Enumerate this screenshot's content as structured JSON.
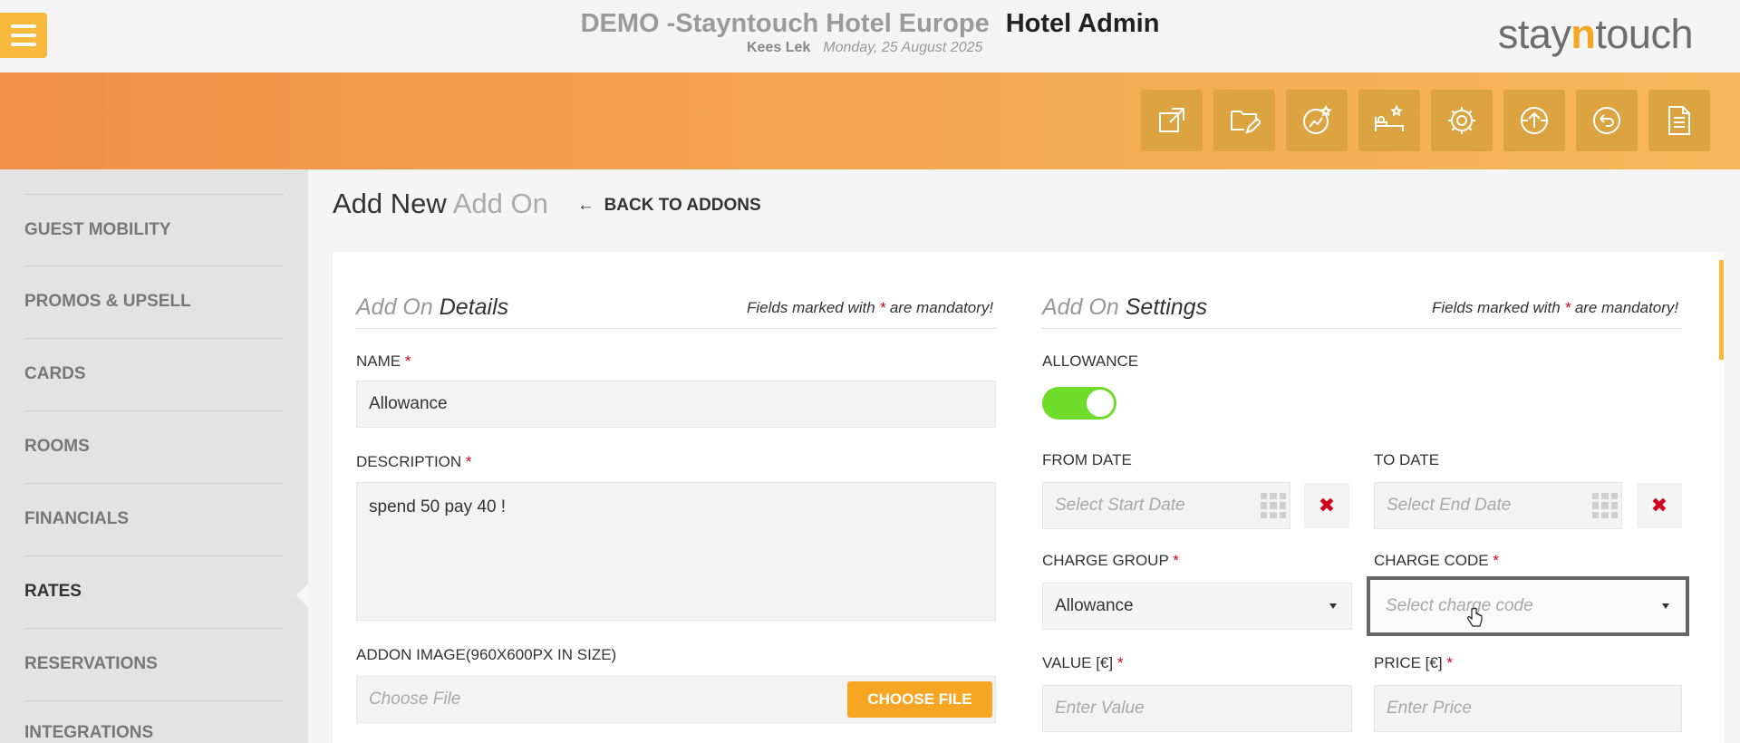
{
  "header": {
    "hotel_name": "DEMO -Stayntouch Hotel Europe",
    "app_name": "Hotel Admin",
    "user": "Kees Lek",
    "date": "Monday, 25 August 2025",
    "logo_left": "stay",
    "logo_n": "n",
    "logo_right": "touch"
  },
  "toolbar_icons": [
    "external-link-icon",
    "folder-edit-icon",
    "chart-star-icon",
    "bed-star-icon",
    "gear-icon",
    "upload-icon",
    "back-arrow-icon",
    "document-icon"
  ],
  "sidebar": {
    "items": [
      {
        "label": "GUEST MOBILITY",
        "active": false
      },
      {
        "label": "PROMOS & UPSELL",
        "active": false
      },
      {
        "label": "CARDS",
        "active": false
      },
      {
        "label": "ROOMS",
        "active": false
      },
      {
        "label": "FINANCIALS",
        "active": false
      },
      {
        "label": "RATES",
        "active": true
      },
      {
        "label": "RESERVATIONS",
        "active": false
      },
      {
        "label": "INTEGRATIONS",
        "active": false
      }
    ]
  },
  "page": {
    "title_dark": "Add New",
    "title_light": "Add On",
    "back_label": "BACK TO ADDONS"
  },
  "details": {
    "title_light": "Add On",
    "title_dark": "Details",
    "mandatory_pre": "Fields marked with",
    "mandatory_star": "*",
    "mandatory_post": "are mandatory!",
    "name_label": "NAME",
    "name_value": "Allowance",
    "description_label": "DESCRIPTION",
    "description_value": "spend 50 pay 40 !",
    "image_label": "ADDON IMAGE(960X600PX IN SIZE)",
    "file_placeholder": "Choose File",
    "choose_file_button": "CHOOSE FILE"
  },
  "settings": {
    "title_light": "Add On",
    "title_dark": "Settings",
    "mandatory_pre": "Fields marked with",
    "mandatory_star": "*",
    "mandatory_post": "are mandatory!",
    "allowance_label": "ALLOWANCE",
    "allowance_on": true,
    "from_date_label": "FROM DATE",
    "from_date_placeholder": "Select Start Date",
    "to_date_label": "TO DATE",
    "to_date_placeholder": "Select End Date",
    "charge_group_label": "CHARGE GROUP",
    "charge_group_value": "Allowance",
    "charge_code_label": "CHARGE CODE",
    "charge_code_placeholder": "Select charge code",
    "value_label": "VALUE [€]",
    "value_placeholder": "Enter Value",
    "price_label": "PRICE [€]",
    "price_placeholder": "Enter Price",
    "required_star": "*",
    "clear_symbol": "✖"
  },
  "colors": {
    "accent_orange": "#f6a623",
    "toggle_green": "#6fdc2a",
    "required_red": "#d0021b"
  }
}
